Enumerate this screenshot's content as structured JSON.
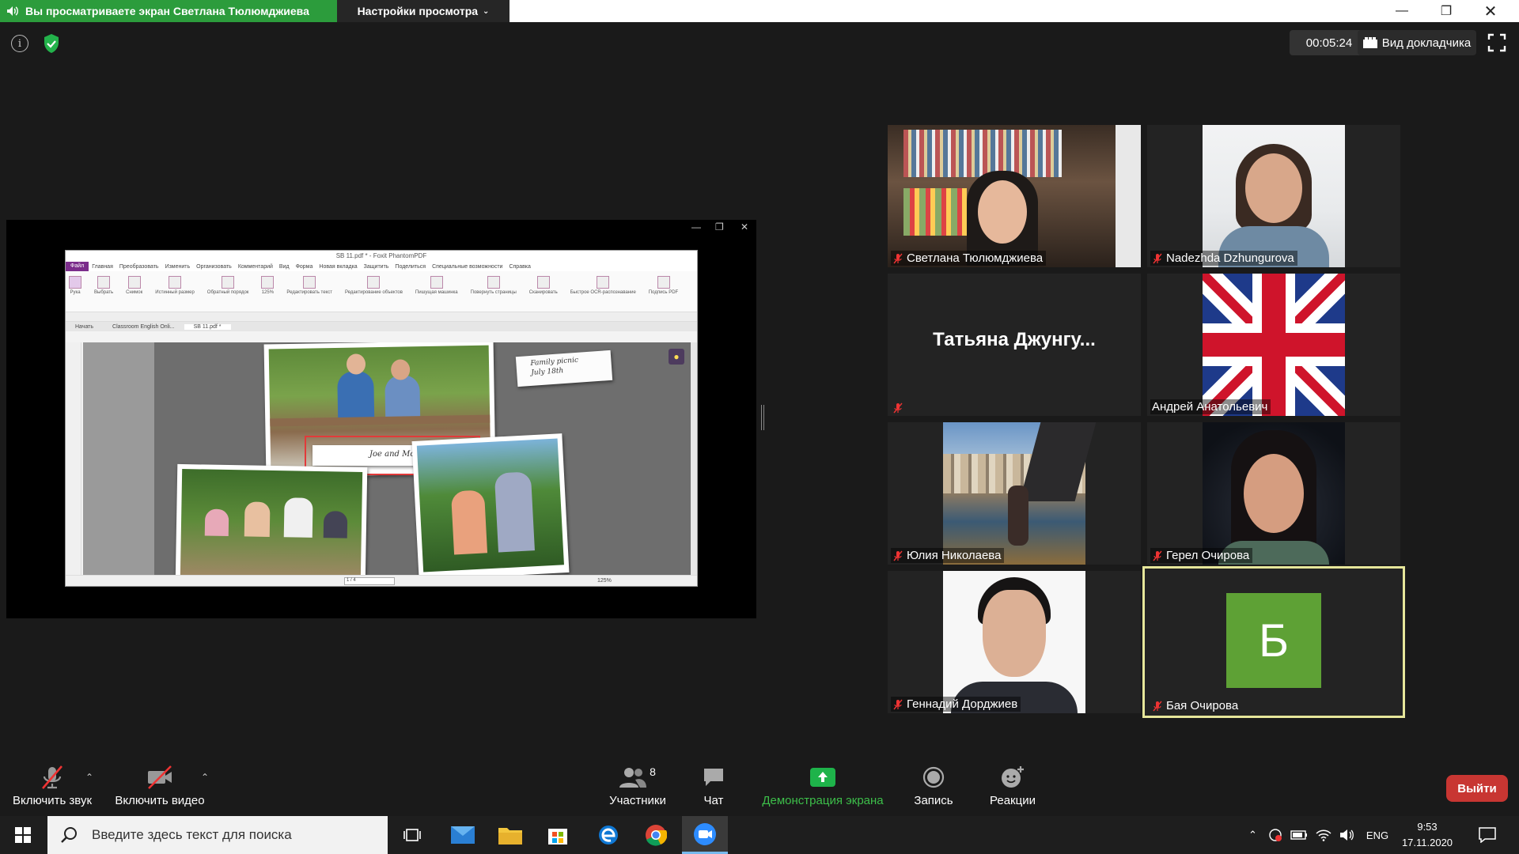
{
  "topbar": {
    "share_banner": "Вы просматриваете экран Светлана Тюлюмджиева",
    "view_settings": "Настройки просмотра"
  },
  "meeting": {
    "timer": "00:05:24",
    "speaker_view": "Вид докладчика"
  },
  "shared": {
    "window_title": "SB 11.pdf * - Foxit PhantomPDF",
    "menu": [
      "Файл",
      "Главная",
      "Преобразовать",
      "Изменить",
      "Организовать",
      "Комментарий",
      "Вид",
      "Форма",
      "Новая вкладка",
      "Защитить",
      "Поделиться",
      "Специальные возможности",
      "Справка"
    ],
    "ribbon": [
      "Рука",
      "Выбрать",
      "Снимок",
      "Истинный размер",
      "Обратный порядок",
      "125%",
      "Редактировать текст",
      "Редактирование объектов",
      "Пишущая машинка",
      "Повернуть страницы",
      "Сканировать",
      "Быстрое OCR-распознавание",
      "Подпись PDF"
    ],
    "tabs": [
      "Начать",
      "Classroom English Onli...",
      "SB 11.pdf *"
    ],
    "caption_top": "Family picnic July 18th",
    "caption_mid": "Joe and Molly",
    "page_indicator": "1 / 4",
    "zoom": "125%"
  },
  "participants": [
    {
      "name": "Светлана Тюлюмджиева"
    },
    {
      "name": "Nadezhda Dzhungurova"
    },
    {
      "name": "Татьяна Джунгу...",
      "display_name": "Татьяна  Джунгу..."
    },
    {
      "name": "Андрей Анатольевич"
    },
    {
      "name": "Юлия Николаева"
    },
    {
      "name": "Герел Очирова"
    },
    {
      "name": "Геннадий Дорджиев"
    },
    {
      "name": "Бая Очирова",
      "avatar_letter": "Б",
      "avatar_color": "#5ea135"
    }
  ],
  "toolbar": {
    "audio": "Включить звук",
    "video": "Включить видео",
    "participants": "Участники",
    "participants_count": "8",
    "chat": "Чат",
    "share": "Демонстрация экрана",
    "record": "Запись",
    "reactions": "Реакции",
    "leave": "Выйти"
  },
  "taskbar": {
    "search_placeholder": "Введите здесь текст для поиска",
    "language": "ENG",
    "time": "9:53",
    "date": "17.11.2020"
  },
  "colors": {
    "share_green": "#2c9c3c",
    "leave_red": "#c83632",
    "active_speaker": "#e6e69a",
    "share_label": "#3dbf4a"
  }
}
